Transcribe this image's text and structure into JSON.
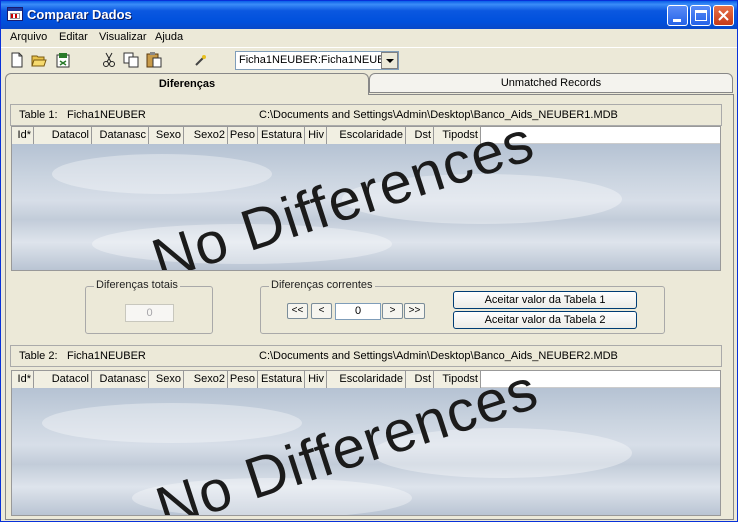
{
  "window": {
    "title": "Comparar Dados"
  },
  "menu": [
    "Arquivo",
    "Editar",
    "Visualizar",
    "Ajuda"
  ],
  "toolbar": {
    "combo_value": "Ficha1NEUBER:Ficha1NEUB"
  },
  "tabs": [
    {
      "label": "Diferenças",
      "active": true
    },
    {
      "label": "Unmatched Records",
      "active": false
    }
  ],
  "table1": {
    "label": "Table 1:",
    "name": "Ficha1NEUBER",
    "path": "C:\\Documents and Settings\\Admin\\Desktop\\Banco_Aids_NEUBER1.MDB",
    "watermark": "No Differences"
  },
  "table2": {
    "label": "Table 2:",
    "name": "Ficha1NEUBER",
    "path": "C:\\Documents and Settings\\Admin\\Desktop\\Banco_Aids_NEUBER2.MDB",
    "watermark": "No Differences"
  },
  "columns": [
    "Id*",
    "Datacol",
    "Datanasc",
    "Sexo",
    "Sexo2",
    "Peso",
    "Estatura",
    "Hiv",
    "Escolaridade",
    "Dst",
    "Tipodst"
  ],
  "totais": {
    "label": "Diferenças totais",
    "value": "0"
  },
  "correntes": {
    "label": "Diferenças correntes",
    "first": "<<",
    "prev": "<",
    "value": "0",
    "next": ">",
    "last": ">>",
    "accept1": "Aceitar valor da Tabela 1",
    "accept2": "Aceitar valor da Tabela 2"
  },
  "colors": {
    "titlebar": "#0050DC",
    "face": "#ECE9D8"
  }
}
